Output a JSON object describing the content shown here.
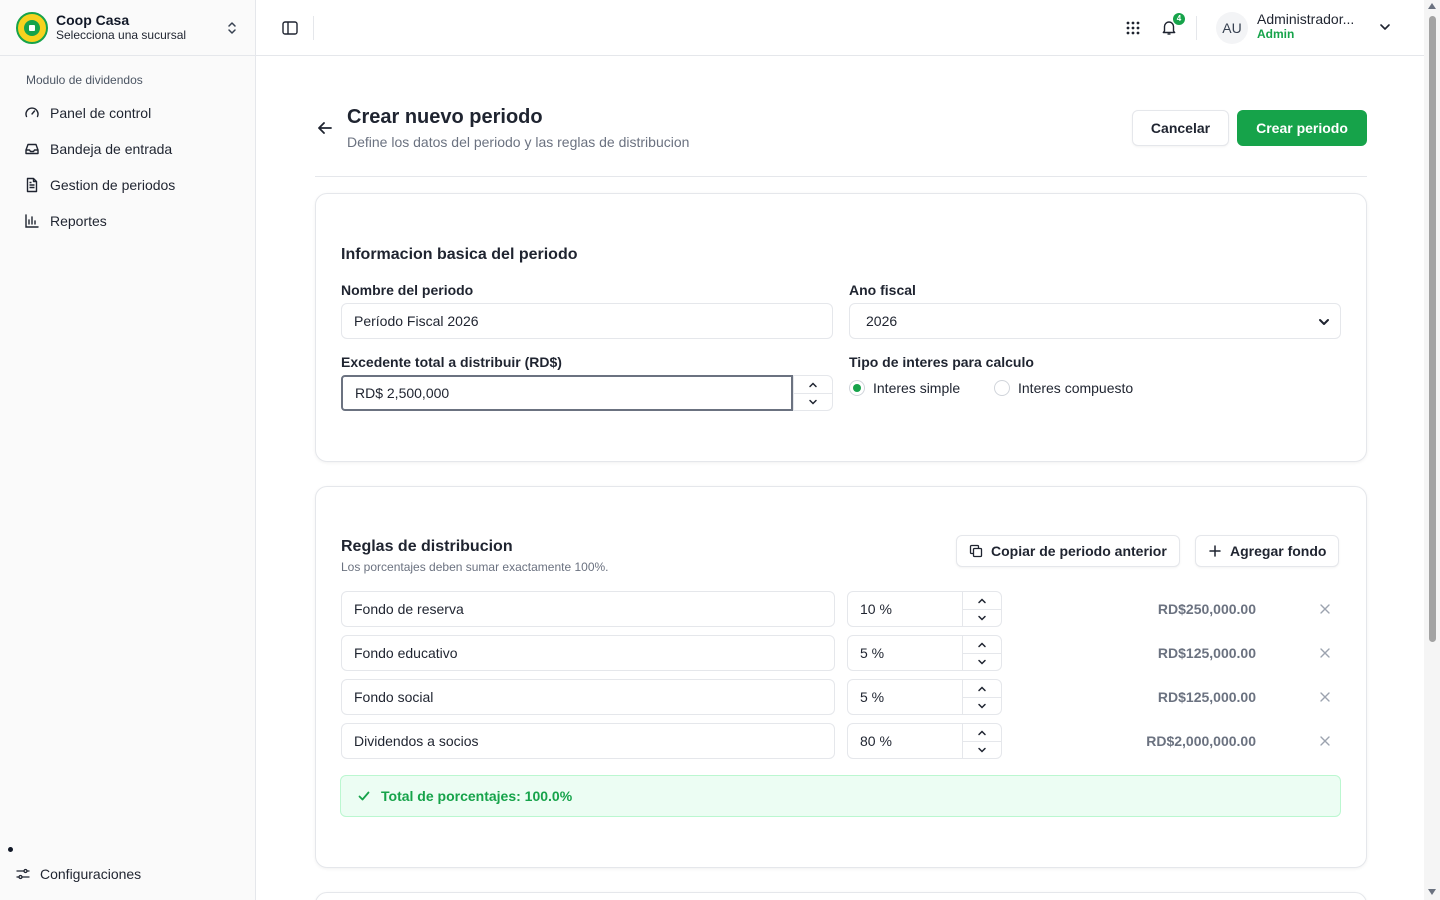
{
  "org": {
    "name": "Coop Casa",
    "subtitle": "Selecciona una sucursal"
  },
  "sidebar": {
    "section_label": "Modulo de dividendos",
    "items": [
      {
        "label": "Panel de control",
        "icon": "gauge-icon"
      },
      {
        "label": "Bandeja de entrada",
        "icon": "inbox-icon"
      },
      {
        "label": "Gestion de periodos",
        "icon": "document-icon"
      },
      {
        "label": "Reportes",
        "icon": "bar-chart-icon"
      }
    ],
    "settings_label": "Configuraciones"
  },
  "topbar": {
    "notification_count": "4",
    "avatar_initials": "AU",
    "user_name": "Administrador...",
    "user_role": "Admin"
  },
  "page": {
    "title": "Crear nuevo periodo",
    "subtitle": "Define los datos del periodo y las reglas de distribucion",
    "cancel_label": "Cancelar",
    "create_label": "Crear periodo"
  },
  "basic_info": {
    "title": "Informacion basica del periodo",
    "name_label": "Nombre del periodo",
    "name_value": "Período Fiscal 2026",
    "fiscal_year_label": "Ano fiscal",
    "fiscal_year_value": "2026",
    "surplus_label": "Excedente total a distribuir (RD$)",
    "surplus_value": "RD$ 2,500,000",
    "interest_label": "Tipo de interes para calculo",
    "interest_options": [
      {
        "label": "Interes simple",
        "selected": true
      },
      {
        "label": "Interes compuesto",
        "selected": false
      }
    ]
  },
  "distribution": {
    "title": "Reglas de distribucion",
    "subtitle": "Los porcentajes deben sumar exactamente 100%.",
    "copy_label": "Copiar de periodo anterior",
    "add_label": "Agregar fondo",
    "rules": [
      {
        "name": "Fondo de reserva",
        "percent": "10 %",
        "amount": "RD$250,000.00"
      },
      {
        "name": "Fondo educativo",
        "percent": "5 %",
        "amount": "RD$125,000.00"
      },
      {
        "name": "Fondo social",
        "percent": "5 %",
        "amount": "RD$125,000.00"
      },
      {
        "name": "Dividendos a socios",
        "percent": "80 %",
        "amount": "RD$2,000,000.00"
      }
    ],
    "total_text": "Total de porcentajes: 100.0%"
  },
  "colors": {
    "accent": "#16a34a",
    "success_bg": "#ecfdf3"
  }
}
